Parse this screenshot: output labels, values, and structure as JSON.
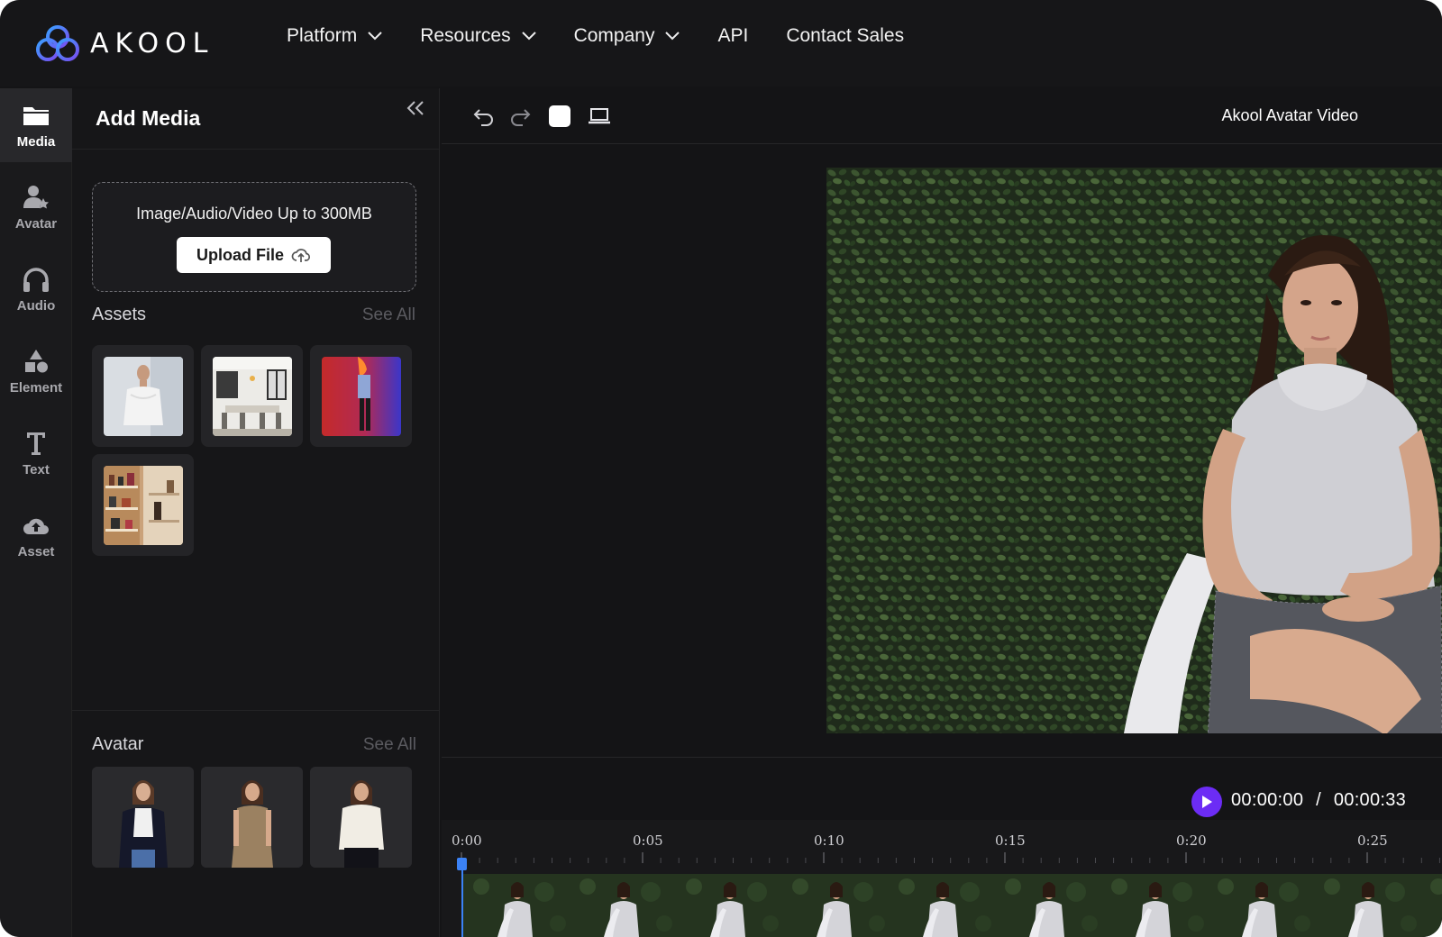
{
  "brand": {
    "name": "AKOOL"
  },
  "nav": {
    "items": [
      {
        "label": "Platform",
        "dropdown": true
      },
      {
        "label": "Resources",
        "dropdown": true
      },
      {
        "label": "Company",
        "dropdown": true
      },
      {
        "label": "API",
        "dropdown": false
      },
      {
        "label": "Contact Sales",
        "dropdown": false
      }
    ]
  },
  "rail": {
    "items": [
      {
        "label": "Media",
        "icon": "folder-icon",
        "active": true
      },
      {
        "label": "Avatar",
        "icon": "avatar-icon",
        "active": false
      },
      {
        "label": "Audio",
        "icon": "headphones-icon",
        "active": false
      },
      {
        "label": "Element",
        "icon": "shapes-icon",
        "active": false
      },
      {
        "label": "Text",
        "icon": "text-icon",
        "active": false
      },
      {
        "label": "Asset",
        "icon": "cloud-icon",
        "active": false
      }
    ]
  },
  "panel": {
    "title": "Add Media",
    "upload": {
      "hint": "Image/Audio/Video Up to 300MB",
      "button": "Upload File"
    },
    "assets": {
      "label": "Assets",
      "see_all": "See All"
    },
    "avatar": {
      "label": "Avatar",
      "see_all": "See All"
    }
  },
  "editor": {
    "project_title": "Akool Avatar Video",
    "time_current": "00:00:00",
    "time_separator": "/",
    "time_total": "00:00:33",
    "timeline_ticks": [
      "0:00",
      "0:05",
      "0:10",
      "0:15",
      "0:20",
      "0:25"
    ]
  },
  "colors": {
    "accent_play": "#6c2cf5",
    "playhead": "#3b82f6",
    "logo_blue": "#3a6df0",
    "logo_purple": "#7a4cf0"
  }
}
